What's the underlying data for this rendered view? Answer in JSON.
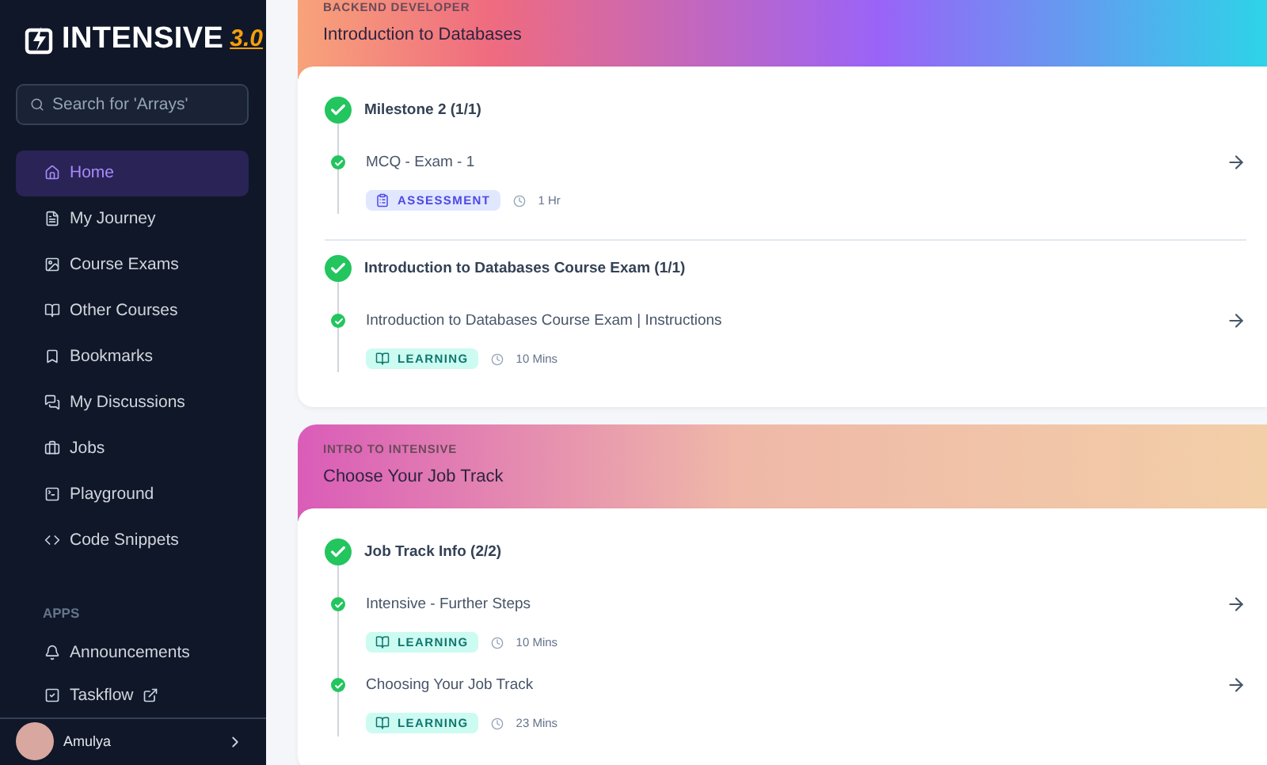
{
  "sidebar": {
    "logo": {
      "text": "INTENSIVE",
      "version": "3.0"
    },
    "search": {
      "placeholder": "Search for 'Arrays'"
    },
    "items": [
      {
        "label": "Home",
        "selected": true
      },
      {
        "label": "My Journey",
        "selected": false
      },
      {
        "label": "Course Exams",
        "selected": false
      },
      {
        "label": "Other Courses",
        "selected": false
      },
      {
        "label": "Bookmarks",
        "selected": false
      },
      {
        "label": "My Discussions",
        "selected": false
      },
      {
        "label": "Jobs",
        "selected": false
      },
      {
        "label": "Playground",
        "selected": false
      },
      {
        "label": "Code Snippets",
        "selected": false
      }
    ],
    "apps_heading": "APPS",
    "apps": [
      {
        "label": "Announcements",
        "kind": "internal"
      },
      {
        "label": "Taskflow",
        "kind": "external"
      }
    ],
    "user": {
      "name": "Amulya"
    }
  },
  "sections": [
    {
      "eyebrow": "BACKEND DEVELOPER",
      "title": "Introduction to Databases",
      "color": "#9a63f8",
      "groups": [
        {
          "title": "Milestone 2 (1/1)",
          "completed": true,
          "items": [
            {
              "title": "MCQ - Exam - 1",
              "completed": true,
              "tag": {
                "kind": "assessment",
                "label": "ASSESSMENT"
              },
              "duration": "1 Hr"
            }
          ]
        },
        {
          "title": "Introduction to Databases Course Exam (1/1)",
          "completed": true,
          "items": [
            {
              "title": "Introduction to Databases Course Exam | Instructions",
              "completed": true,
              "tag": {
                "kind": "learning",
                "label": "LEARNING"
              },
              "duration": "10 Mins"
            }
          ]
        }
      ]
    },
    {
      "eyebrow": "INTRO TO INTENSIVE",
      "title": "Choose Your Job Track",
      "color": "#efb8a8",
      "groups": [
        {
          "title": "Job Track Info (2/2)",
          "completed": true,
          "items": [
            {
              "title": "Intensive - Further Steps",
              "completed": true,
              "tag": {
                "kind": "learning",
                "label": "LEARNING"
              },
              "duration": "10 Mins"
            },
            {
              "title": "Choosing Your Job Track",
              "completed": true,
              "tag": {
                "kind": "learning",
                "label": "LEARNING"
              },
              "duration": "23 Mins"
            }
          ]
        }
      ]
    }
  ]
}
